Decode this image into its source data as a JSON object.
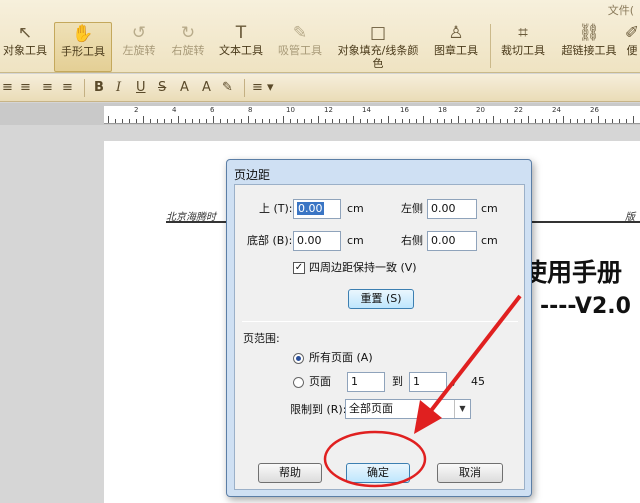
{
  "toolbar": {
    "top_right_text": "文件(",
    "buttons": [
      {
        "label": "对象工具",
        "icon": "↖"
      },
      {
        "label": "手形工具",
        "icon": "✋"
      },
      {
        "label": "左旋转",
        "icon": "↺"
      },
      {
        "label": "右旋转",
        "icon": "↻"
      },
      {
        "label": "文本工具",
        "icon": "T"
      },
      {
        "label": "吸管工具",
        "icon": "✎"
      },
      {
        "label": "对象填充/线条颜色",
        "icon": "□"
      },
      {
        "label": "图章工具",
        "icon": "♙"
      },
      {
        "label": "裁切工具",
        "icon": "⌗"
      },
      {
        "label": "超链接工具",
        "icon": "⛓"
      },
      {
        "label": "便",
        "icon": "✐"
      }
    ]
  },
  "formatbar": {
    "align_icons": [
      "≡",
      "≡",
      "≡",
      "≡"
    ],
    "bold": "B",
    "italic": "I",
    "underline": "U",
    "strike": "S",
    "superscript": "A",
    "subscript": "A",
    "clear": "✎",
    "line_spacing": "≡ ▾"
  },
  "ruler": {
    "numbers": [
      "2",
      "4",
      "6",
      "8",
      "10",
      "12",
      "14",
      "16",
      "18",
      "20",
      "22",
      "24",
      "26"
    ]
  },
  "document": {
    "header_left": "北京海腾时",
    "header_right": "版",
    "title": "使用手册",
    "version": "----V2.0"
  },
  "dialog": {
    "title": "页边距",
    "top_label": "上 (T):",
    "top_value": "0.00",
    "left_label": "左侧",
    "left_value": "0.00",
    "bottom_label": "底部 (B):",
    "bottom_value": "0.00",
    "right_label": "右侧",
    "right_value": "0.00",
    "unit": "cm",
    "keep_same_label": "四周边距保持一致 (V)",
    "keep_same_checked": true,
    "reset_label": "重置 (S)",
    "page_range_label": "页范围:",
    "all_pages_label": "所有页面 (A)",
    "pages_label": "页面",
    "from_value": "1",
    "to_label": "到",
    "to_value": "1",
    "slash": "/",
    "total_pages": "45",
    "limit_label": "限制到 (R):",
    "limit_value": "全部页面",
    "help_label": "帮助",
    "ok_label": "确定",
    "cancel_label": "取消"
  },
  "annotation_color": "#e02020"
}
